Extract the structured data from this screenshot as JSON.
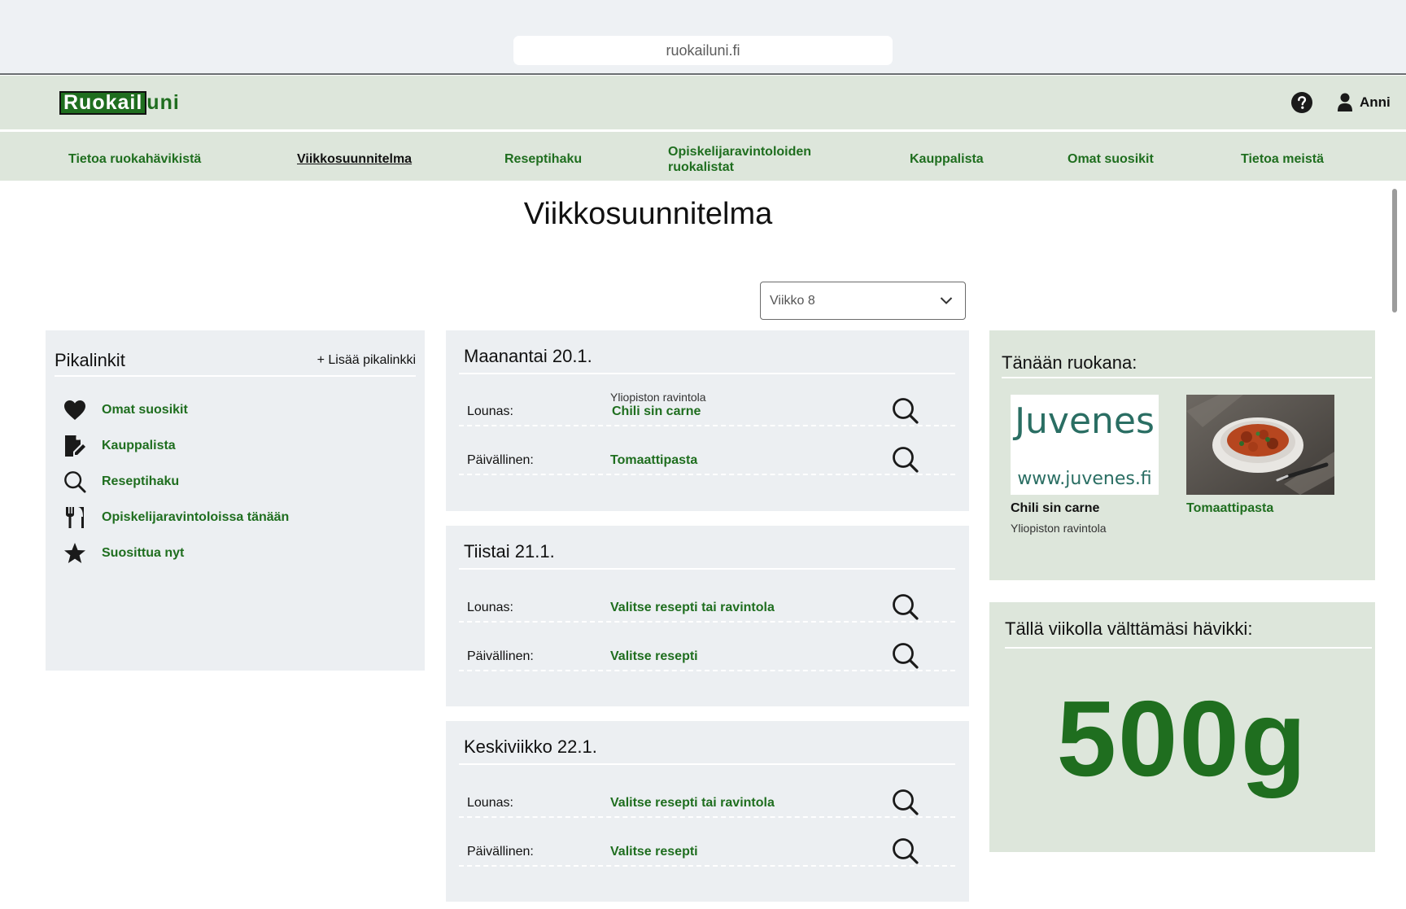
{
  "browser": {
    "url": "ruokailuni.fi"
  },
  "header": {
    "logo_boxed": "Ruokail",
    "logo_rest": "uni",
    "user_name": "Anni"
  },
  "nav": [
    {
      "label": "Tietoa ruokahävikistä",
      "active": false
    },
    {
      "label": "Viikkosuunnitelma",
      "active": true
    },
    {
      "label": "Reseptihaku",
      "active": false
    },
    {
      "label": "Opiskelijaravintoloiden ruokalistat",
      "active": false
    },
    {
      "label": "Kauppalista",
      "active": false
    },
    {
      "label": "Omat suosikit",
      "active": false
    },
    {
      "label": "Tietoa meistä",
      "active": false
    }
  ],
  "page": {
    "title": "Viikkosuunnitelma"
  },
  "week_select": {
    "value": "Viikko 8"
  },
  "quick_links": {
    "title": "Pikalinkit",
    "add_label": "+ Lisää pikalinkki",
    "items": [
      {
        "icon": "heart-icon",
        "label": "Omat suosikit"
      },
      {
        "icon": "shopping-list-icon",
        "label": "Kauppalista"
      },
      {
        "icon": "search-icon",
        "label": "Reseptihaku"
      },
      {
        "icon": "cutlery-icon",
        "label": "Opiskelijaravintoloissa tänään"
      },
      {
        "icon": "star-icon",
        "label": "Suosittua nyt"
      }
    ]
  },
  "days": [
    {
      "title": "Maanantai 20.1.",
      "lunch_label": "Lounas:",
      "lunch_sub": "Yliopiston ravintola",
      "lunch_value": "Chili sin carne",
      "dinner_label": "Päivällinen:",
      "dinner_value": "Tomaattipasta"
    },
    {
      "title": "Tiistai 21.1.",
      "lunch_label": "Lounas:",
      "lunch_value": "Valitse resepti tai ravintola",
      "dinner_label": "Päivällinen:",
      "dinner_value": "Valitse resepti"
    },
    {
      "title": "Keskiviikko 22.1.",
      "lunch_label": "Lounas:",
      "lunch_value": "Valitse resepti tai ravintola",
      "dinner_label": "Päivällinen:",
      "dinner_value": "Valitse resepti"
    }
  ],
  "today": {
    "title": "Tänään ruokana:",
    "items": [
      {
        "image_text_1": "Juvenes",
        "image_text_2": "www.juvenes.fi",
        "name": "Chili sin carne",
        "sub": "Yliopiston ravintola"
      },
      {
        "name": "Tomaattipasta"
      }
    ]
  },
  "waste": {
    "title": "Tällä viikolla välttämäsi hävikki:",
    "value": "500g"
  },
  "colors": {
    "brand_green": "#1f6e1f",
    "header_bg": "#dde6db",
    "panel_bg": "#eceff2"
  }
}
